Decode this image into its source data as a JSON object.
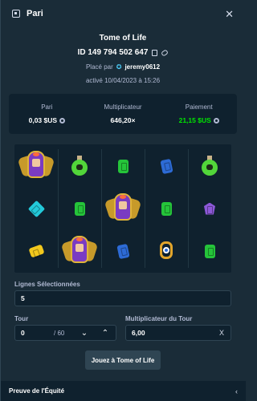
{
  "header": {
    "title": "Pari",
    "close_icon": "close-icon"
  },
  "game": {
    "name": "Tome of Life"
  },
  "bet": {
    "id": "ID 149 794 502 647",
    "placed_prefix": "Placé par",
    "user": "jeremy0612",
    "activated": "activé 10/04/2023 à 15:26"
  },
  "stats": {
    "bet_label": "Pari",
    "bet_value": "0,03 $US",
    "multiplier_label": "Multiplicateur",
    "multiplier_value": "646,20×",
    "payout_label": "Paiement",
    "payout_value": "21,15 $US",
    "payout_color": "#00e701"
  },
  "board": {
    "columns": 5,
    "rows": 3,
    "cells": [
      [
        "pharaoh",
        "potion",
        "gem-green",
        "gem-blue",
        "potion"
      ],
      [
        "gem-cyan",
        "gem-green",
        "pharaoh",
        "gem-green",
        "gem-purple"
      ],
      [
        "gem-yellow",
        "pharaoh",
        "gem-blue",
        "amulet",
        "gem-green"
      ]
    ]
  },
  "form": {
    "lines_label": "Lignes Sélectionnées",
    "lines_value": "5",
    "round_label": "Tour",
    "round_value": "0",
    "round_total": "/ 60",
    "round_multiplier_label": "Multiplicateur du Tour",
    "round_multiplier_value": "6,00",
    "clear_symbol": "X"
  },
  "play_button": {
    "label": "Jouez à Tome of Life"
  },
  "footer": {
    "label": "Preuve de l'Équité"
  },
  "colors": {
    "background": "#1a2c38",
    "panel_dark": "#0f212e",
    "muted": "#b1bad3"
  }
}
